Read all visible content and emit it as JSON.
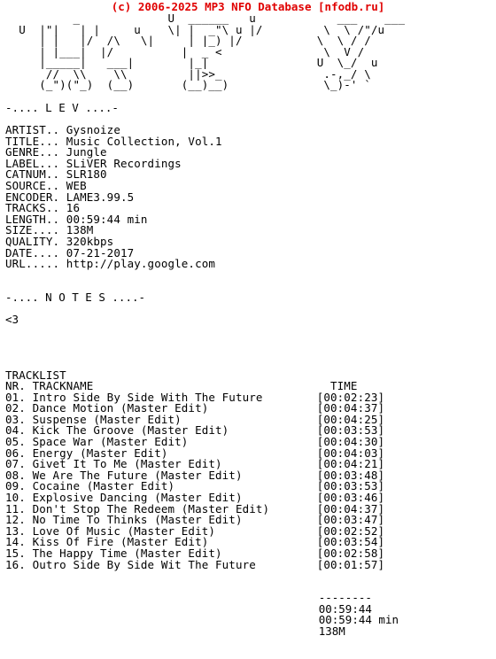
{
  "banner": {
    "text": "(c) 2006-2025 MP3 NFO Database [nfodb.ru]",
    "color": "#e00000"
  },
  "ascii_logo": "       _                  U ______   u          _____                   \n  U  |\"|  | |     u      U |  _\"\\ u   __   __  \n   \\| |  |/ /\\    \\ |\u0007    \\| |_) |/   \\ \\ / /  \n    | |___      |  |      |  __/      /\\ V /\\  \n    |_____|     |_|       |_|        U  \\_/  u \n    //  \\\\      _//       ||>>_      .-,_/ \\   \n   (_\")(\"_)    (__)      (__)__)      \\_)-' `\u0007 ",
  "ascii_lines": [
    "             _                           U  ______   u               _____                    ",
    "    U  |\"|   | |     u                   \\| |  _\"\\/ |/                  \\ \\ /\"/u              ",
    "        | |   |/ /\\     \\ |                 | |_) |                      /\\ V /  \\            ",
    "        |_|  |___|   |                      |  __/                   U  \\_/  u                ",
    "        //    \\\\    _//                     ||>>_                      .-,_/ \\                ",
    "       (_\")(\"_)   (__)                     (__)__)                     \\_)-' `                "
  ],
  "sections": {
    "info_header": "-.... L E V ....-",
    "notes_header": "-.... N O T E S ....-",
    "notes_body": "<3",
    "tracklist_header": "TRACKLIST",
    "tracklist_columns": {
      "nr": "NR.",
      "trackname": "TRACKNAME",
      "time": "TIME"
    }
  },
  "info": {
    "fields": [
      {
        "label": "ARTIST..",
        "value": "Gysnoize"
      },
      {
        "label": "TITLE...",
        "value": "Music Collection, Vol.1"
      },
      {
        "label": "GENRE...",
        "value": "Jungle"
      },
      {
        "label": "LABEL...",
        "value": "SLiVER Recordings"
      },
      {
        "label": "CATNUM..",
        "value": "SLR180"
      },
      {
        "label": "SOURCE..",
        "value": "WEB"
      },
      {
        "label": "ENCODER.",
        "value": "LAME3.99.5"
      },
      {
        "label": "TRACKS..",
        "value": "16"
      },
      {
        "label": "LENGTH..",
        "value": "00:59:44 min"
      },
      {
        "label": "SIZE....",
        "value": "138M"
      },
      {
        "label": "QUALITY.",
        "value": "320kbps"
      },
      {
        "label": "DATE....",
        "value": "07-21-2017"
      },
      {
        "label": "URL.....",
        "value": "http://play.google.com"
      }
    ]
  },
  "tracklist": {
    "tracks": [
      {
        "nr": "01.",
        "name": "Intro Side By Side With The Future",
        "time": "[00:02:23]"
      },
      {
        "nr": "02.",
        "name": "Dance Motion (Master Edit)",
        "time": "[00:04:37]"
      },
      {
        "nr": "03.",
        "name": "Suspense (Master Edit)",
        "time": "[00:04:25]"
      },
      {
        "nr": "04.",
        "name": "Kick The Groove (Master Edit)",
        "time": "[00:03:53]"
      },
      {
        "nr": "05.",
        "name": "Space War (Master Edit)",
        "time": "[00:04:30]"
      },
      {
        "nr": "06.",
        "name": "Energy (Master Edit)",
        "time": "[00:04:03]"
      },
      {
        "nr": "07.",
        "name": "Givet It To Me (Master Edit)",
        "time": "[00:04:21]"
      },
      {
        "nr": "08.",
        "name": "We Are The Future (Master Edit)",
        "time": "[00:03:48]"
      },
      {
        "nr": "09.",
        "name": "Cocaine (Master Edit)",
        "time": "[00:03:53]"
      },
      {
        "nr": "10.",
        "name": "Explosive Dancing (Master Edit)",
        "time": "[00:03:46]"
      },
      {
        "nr": "11.",
        "name": "Don't Stop The Redeem (Master Edit)",
        "time": "[00:04:37]"
      },
      {
        "nr": "12.",
        "name": "No Time To Thinks (Master Edit)",
        "time": "[00:03:47]"
      },
      {
        "nr": "13.",
        "name": "Love Of Music (Master Edit)",
        "time": "[00:02:52]"
      },
      {
        "nr": "14.",
        "name": "Kiss Of Fire (Master Edit)",
        "time": "[00:03:54]"
      },
      {
        "nr": "15.",
        "name": "The Happy Time (Master Edit)",
        "time": "[00:02:58]"
      },
      {
        "nr": "16.",
        "name": "Outro Side By Side Wit The Future",
        "time": "[00:01:57]"
      }
    ]
  },
  "totals": {
    "rule": "--------",
    "total_time": "00:59:44",
    "total_length": "00:59:44 min",
    "total_size": "138M"
  }
}
